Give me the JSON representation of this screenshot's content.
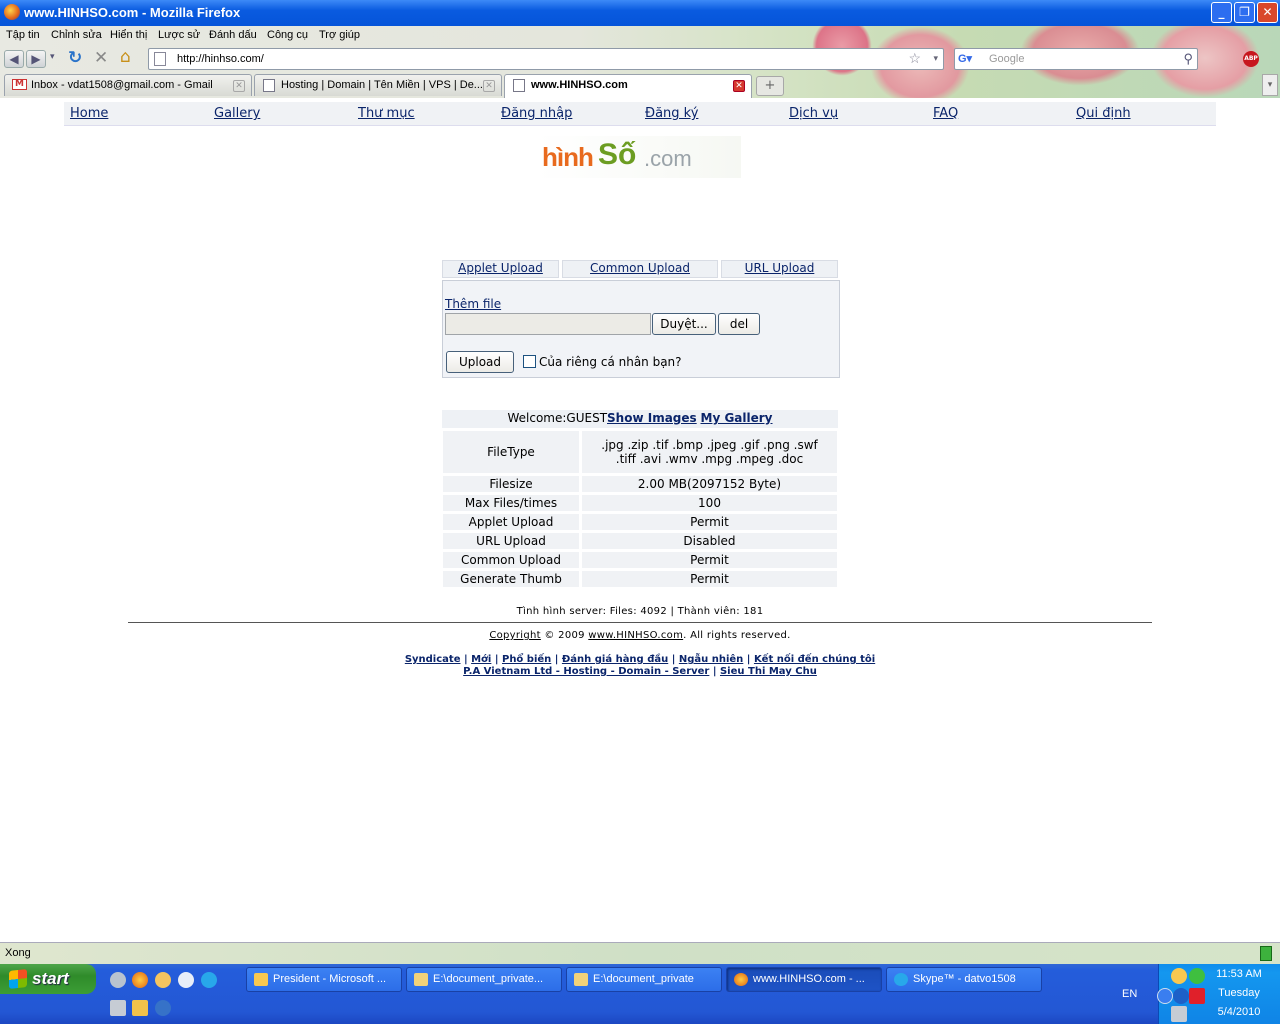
{
  "window": {
    "title": "www.HINHSO.com - Mozilla Firefox"
  },
  "menu": [
    "Tập tin",
    "Chỉnh sửa",
    "Hiển thị",
    "Lược sử",
    "Đánh dấu",
    "Công cụ",
    "Trợ giúp"
  ],
  "toolbar": {
    "url": "http://hinhso.com/",
    "search_placeholder": "Google",
    "abp_label": "ABP"
  },
  "tabs": [
    {
      "label": "Inbox - vdat1508@gmail.com - Gmail"
    },
    {
      "label": "Hosting | Domain | Tên Miền | VPS | De..."
    },
    {
      "label": "www.HINHSO.com"
    }
  ],
  "site": {
    "nav": [
      "Home",
      "Gallery",
      "Thư mục",
      "Đăng nhập",
      "Đăng ký",
      "Dịch vụ",
      "FAQ",
      "Qui định"
    ],
    "logo": {
      "part1": "hình",
      "part2": "Số",
      "part3": ".com"
    },
    "upload_tabs": [
      "Applet Upload",
      "Common Upload",
      "URL Upload"
    ],
    "add_file": "Thêm file",
    "browse_label": "Duyệt...",
    "del_label": "del",
    "upload_label": "Upload",
    "private_label": "Của riêng cá nhân bạn?",
    "welcome_prefix": "Welcome:GUEST",
    "show_images": "Show Images",
    "my_gallery": "My Gallery",
    "info_rows": [
      {
        "label": "FileType",
        "value": ".jpg .zip .tif .bmp .jpeg .gif .png .swf .tiff .avi .wmv .mpg .mpeg .doc"
      },
      {
        "label": "Filesize",
        "value": "2.00 MB(2097152 Byte)"
      },
      {
        "label": "Max Files/times",
        "value": "100"
      },
      {
        "label": "Applet Upload",
        "value": "Permit"
      },
      {
        "label": "URL Upload",
        "value": "Disabled"
      },
      {
        "label": "Common Upload",
        "value": "Permit"
      },
      {
        "label": "Generate Thumb",
        "value": "Permit"
      }
    ],
    "server_stats": "Tình hình server: Files: 4092 | Thành viên: 181",
    "copyright_word": "Copyright",
    "copyright_mid": "© 2009",
    "copyright_link": "www.HINHSO.com",
    "copyright_end": ". All rights reserved.",
    "footer_links_1": [
      "Syndicate",
      "Mới",
      "Phổ biến",
      "Đánh giá hàng đầu",
      "Ngẫu nhiên",
      "Kết nối đến chúng tôi"
    ],
    "footer_links_2": [
      "P.A Vietnam Ltd - Hosting - Domain - Server",
      "Sieu Thi May Chu"
    ]
  },
  "statusbar": {
    "text": "Xong"
  },
  "taskbar": {
    "start": "start",
    "buttons": [
      {
        "label": "President - Microsoft ..."
      },
      {
        "label": "E:\\document_private..."
      },
      {
        "label": "E:\\document_private"
      },
      {
        "label": "www.HINHSO.com - ..."
      },
      {
        "label": "Skype™ - datvo1508"
      }
    ],
    "lang": "EN",
    "time": "11:53 AM",
    "day": "Tuesday",
    "date": "5/4/2010"
  },
  "colors": {
    "link": "#0a246a",
    "titlebar": "#0554d9",
    "taskbar": "#245ddb",
    "start": "#3c9d36"
  }
}
